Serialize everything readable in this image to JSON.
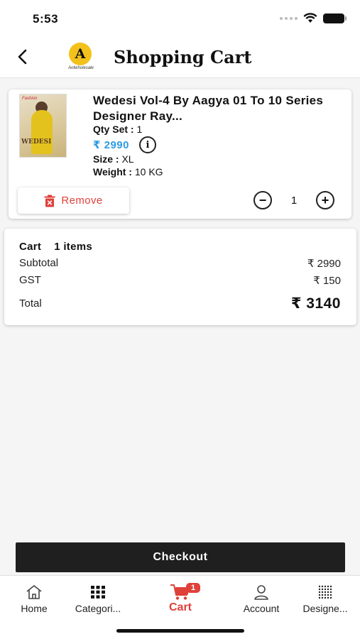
{
  "status_bar": {
    "time": "5:53"
  },
  "header": {
    "title": "Shopping Cart",
    "logo_letter": "A",
    "logo_sub": "Aotwholesale"
  },
  "item": {
    "title": "Wedesi Vol-4 By Aagya 01 To 10 Series Designer Ray...",
    "qty_set_label": "Qty Set :",
    "qty_set_value": "1",
    "price": "₹ 2990",
    "size_label": "Size :",
    "size_value": "XL",
    "weight_label": "Weight :",
    "weight_value": "10 KG",
    "thumb_brand": "WEDESI",
    "thumb_tag": "Fashion",
    "remove_label": "Remove",
    "quantity": "1",
    "decrease_symbol": "−",
    "increase_symbol": "+"
  },
  "summary": {
    "cart_label": "Cart",
    "items_label": "1 items",
    "rows": [
      {
        "label": "Subtotal",
        "value": "₹ 2990"
      },
      {
        "label": "GST",
        "value": "₹ 150"
      }
    ],
    "total_label": "Total",
    "total_value": "₹ 3140"
  },
  "checkout_label": "Checkout",
  "tabbar": {
    "tabs": [
      {
        "label": "Home",
        "icon": "home-icon"
      },
      {
        "label": "Categori...",
        "icon": "grid-icon"
      },
      {
        "label": "Cart",
        "icon": "cart-icon",
        "badge": "1",
        "active": true
      },
      {
        "label": "Account",
        "icon": "user-icon"
      },
      {
        "label": "Designe...",
        "icon": "dots-grid-icon"
      }
    ]
  },
  "colors": {
    "accent": "#e0403a",
    "price": "#2d9be0",
    "checkout_bg": "#1f1f1f",
    "logo_yellow": "#f3c11b"
  }
}
